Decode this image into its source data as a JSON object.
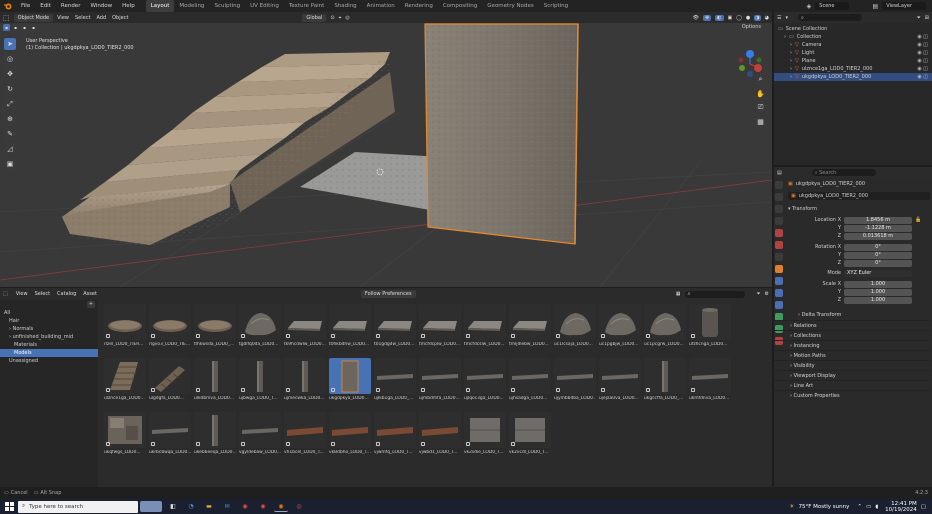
{
  "topbar": {
    "menus": [
      "File",
      "Edit",
      "Render",
      "Window",
      "Help"
    ],
    "workspaces": [
      "Layout",
      "Modeling",
      "Sculpting",
      "UV Editing",
      "Texture Paint",
      "Shading",
      "Animation",
      "Rendering",
      "Compositing",
      "Geometry Nodes",
      "Scripting"
    ],
    "active_workspace": "Layout",
    "scene_label": "Scene",
    "viewlayer_label": "ViewLayer"
  },
  "viewport": {
    "mode": "Object Mode",
    "menus": [
      "View",
      "Select",
      "Add",
      "Object"
    ],
    "transform_orientation": "Global",
    "options_label": "Options",
    "overlay_title": "User Perspective",
    "overlay_subtitle": "(1) Collection | ukgdpkya_LOD0_TIER2_000"
  },
  "outliner": {
    "search_placeholder": "",
    "root": "Scene Collection",
    "items": [
      {
        "label": "Collection",
        "depth": 1,
        "selected": false,
        "color": "#bbbbbb"
      },
      {
        "label": "Camera",
        "depth": 2,
        "selected": false,
        "color": "#e08a3a"
      },
      {
        "label": "Light",
        "depth": 2,
        "selected": false,
        "color": "#e08a3a"
      },
      {
        "label": "Plane",
        "depth": 2,
        "selected": false,
        "color": "#e08a3a"
      },
      {
        "label": "ulznce1ga_LOD0_TIER2_000",
        "depth": 2,
        "selected": false,
        "color": "#e08a3a"
      },
      {
        "label": "ukgdpkya_LOD0_TIER2_000",
        "depth": 2,
        "selected": true,
        "color": "#e08a3a"
      }
    ]
  },
  "properties": {
    "search_placeholder": "Search",
    "object_name": "ukgdpkya_LOD0_TIER2_000",
    "data_name": "ukgdpkya_LOD0_TIER2_000",
    "transform_label": "Transform",
    "location_label": "Location X",
    "loc_x": "1.8456 m",
    "loc_y": "-1.1228 m",
    "loc_z": "0.013618 m",
    "rotation_label": "Rotation X",
    "rot_x": "0°",
    "rot_y": "0°",
    "rot_z": "0°",
    "mode_label": "Mode",
    "mode_value": "XYZ Euler",
    "scale_label": "Scale X",
    "scale_x": "1.000",
    "scale_y": "1.000",
    "scale_z": "1.000",
    "y_label": "Y",
    "z_label": "Z",
    "sections": [
      "Delta Transform",
      "Relations",
      "Collections",
      "Instancing",
      "Motion Paths",
      "Visibility",
      "Viewport Display",
      "Line Art",
      "Custom Properties"
    ]
  },
  "asset_browser": {
    "menus": [
      "View",
      "Select",
      "Catalog",
      "Asset"
    ],
    "library": "Follow Preferences",
    "search_placeholder": "",
    "catalogs": [
      {
        "label": "All",
        "depth": 0,
        "selected": false
      },
      {
        "label": "Hair",
        "depth": 1,
        "selected": false
      },
      {
        "label": "Normals",
        "depth": 1,
        "selected": false
      },
      {
        "label": "unfinished_building_mid",
        "depth": 1,
        "selected": false
      },
      {
        "label": "Materials",
        "depth": 2,
        "selected": false
      },
      {
        "label": "Models",
        "depth": 2,
        "selected": true
      },
      {
        "label": "Unassigned",
        "depth": 1,
        "selected": false
      }
    ],
    "assets": [
      {
        "name": "rlzel_LOD0_TIER...",
        "kind": "disc"
      },
      {
        "name": "rlgvo3_LOD0_TIE...",
        "kind": "disc"
      },
      {
        "name": "tlhkwsda_LOD0_...",
        "kind": "disc"
      },
      {
        "name": "tgdlfq0da_LOD0...",
        "kind": "rock"
      },
      {
        "name": "tk9hcdwlw_LOD0...",
        "kind": "slab"
      },
      {
        "name": "t0hkbdhw_LOD0...",
        "kind": "slab"
      },
      {
        "name": "t01gdgdw_LOD0...",
        "kind": "slab"
      },
      {
        "name": "tmcfdcplw_LOD0...",
        "kind": "slab"
      },
      {
        "name": "tmcfdcslw_LOD0...",
        "kind": "slab"
      },
      {
        "name": "tmljdlebw_LOD0...",
        "kind": "slab"
      },
      {
        "name": "uc1lcsaja_LOD0...",
        "kind": "rock"
      },
      {
        "name": "uc1pgbjw_LOD0...",
        "kind": "rock"
      },
      {
        "name": "uc1pcgrw_LOD0...",
        "kind": "rock"
      },
      {
        "name": "ufzhcnga_LOD0...",
        "kind": "barrel"
      },
      {
        "name": "ulznce1ga_LOD0...",
        "kind": "stair"
      },
      {
        "name": "ulgdgfa_LOD0...",
        "kind": "stair2"
      },
      {
        "name": "ulkdbmva_LOD0...",
        "kind": "pole"
      },
      {
        "name": "ujbwga_LOD0_T...",
        "kind": "pole"
      },
      {
        "name": "ujmecwka_LOD0...",
        "kind": "pole"
      },
      {
        "name": "ukgdpkya_LOD0...",
        "kind": "board"
      },
      {
        "name": "ujlkb1ga_LOD0_...",
        "kind": "plank"
      },
      {
        "name": "ujmbdmfa_LOD0...",
        "kind": "plank"
      },
      {
        "name": "ujlqoc3ga_LOD0...",
        "kind": "plank"
      },
      {
        "name": "ujhsadga_LOD0...",
        "kind": "plank"
      },
      {
        "name": "ujymbbdba_LOD0...",
        "kind": "plank"
      },
      {
        "name": "ujejaa0va_LOD0...",
        "kind": "plank"
      },
      {
        "name": "ukgccffa_LOD0_...",
        "kind": "pole"
      },
      {
        "name": "ukmfdnva_LOD0...",
        "kind": "plank"
      },
      {
        "name": "ukqfwgs_LOD0...",
        "kind": "rubble"
      },
      {
        "name": "ukrbcbwqa_LOD0...",
        "kind": "plank"
      },
      {
        "name": "ukebbeeqa_LOD0...",
        "kind": "pole"
      },
      {
        "name": "vgyldebaw_LOD0...",
        "kind": "plank"
      },
      {
        "name": "vh1bcel_LOD0_T...",
        "kind": "brick"
      },
      {
        "name": "vkBdbho_LOD0_T...",
        "kind": "brick"
      },
      {
        "name": "vjwmfq_LOD0_T...",
        "kind": "brick"
      },
      {
        "name": "vjwbd1_LOD0_T...",
        "kind": "brick"
      },
      {
        "name": "vk2sdie_LOD0_T...",
        "kind": "block"
      },
      {
        "name": "vk2vcdl_LOD0_T...",
        "kind": "block"
      }
    ],
    "selected_asset_index": 19
  },
  "status": {
    "left_text": "Cancel",
    "snap_text": "Alt Snap",
    "version": "4.2.3"
  },
  "taskbar": {
    "search_placeholder": "Type here to search",
    "weather": "75°F  Mostly sunny",
    "time": "12:41 PM",
    "date": "10/19/2024"
  },
  "colors": {
    "accent": "#4772b3",
    "selection_outline": "#e88a2c"
  }
}
